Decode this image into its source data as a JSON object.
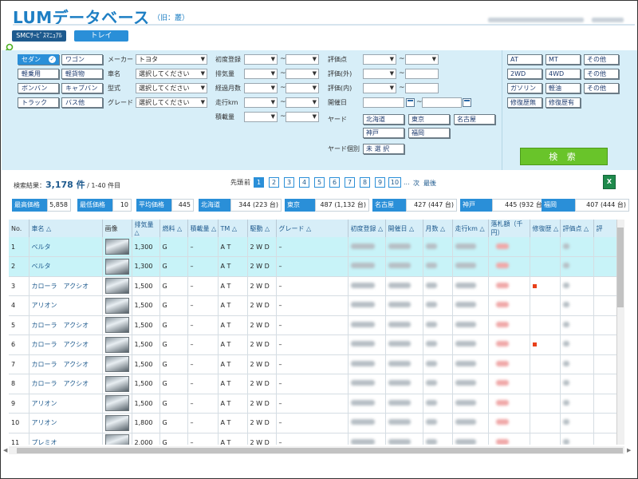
{
  "header": {
    "title": "LUMデータベース",
    "subtitle": "（旧：叢）"
  },
  "nav": {
    "smc_label": "SMCｻｰﾋﾞｽﾏﾆｭｱﾙ",
    "tray_label": "トレイ"
  },
  "categories": [
    {
      "label": "セダン",
      "selected": true
    },
    {
      "label": "ワゴン"
    },
    {
      "label": "軽乗用"
    },
    {
      "label": "軽貨物"
    },
    {
      "label": "ボンバン"
    },
    {
      "label": "キャブバン"
    },
    {
      "label": "トラック"
    },
    {
      "label": "バス他"
    }
  ],
  "filters": {
    "maker_label": "メーカー",
    "maker_value": "トヨタ",
    "model_label": "車名",
    "model_value": "選択してください",
    "type_label": "型式",
    "type_value": "選択してください",
    "grade_label": "グレード",
    "grade_value": "選択してください",
    "first_reg_label": "初度登録",
    "displacement_label": "排気量",
    "months_label": "経過月数",
    "mileage_label": "走行km",
    "load_label": "積載量",
    "score_label": "評価点",
    "score_ext_label": "評価(外)",
    "score_int_label": "評価(内)",
    "date_label": "開催日",
    "yard_label": "ヤード",
    "yard_indiv_label": "ヤード個別",
    "yard_indiv_value": "未 選 択",
    "tilde": "~"
  },
  "yards": [
    "北海道",
    "東京",
    "名古屋",
    "神戸",
    "福岡"
  ],
  "options": [
    "AT",
    "MT",
    "その他",
    "2WD",
    "4WD",
    "その他",
    "ガソリン",
    "軽油",
    "その他",
    "修復歴無",
    "修復歴有"
  ],
  "search_label": "検 索",
  "results": {
    "prefix": "検索結果：",
    "count": "3,178 件",
    "range": "/ 1-40 件目"
  },
  "pager": {
    "first": "先頭",
    "prev": "前",
    "pages": [
      "1",
      "2",
      "3",
      "4",
      "5",
      "6",
      "7",
      "8",
      "9",
      "10"
    ],
    "ellipsis": "...",
    "next": "次",
    "last": "最後"
  },
  "stats": [
    {
      "k": "最高価格",
      "v": "5,858"
    },
    {
      "k": "最低価格",
      "v": "10"
    },
    {
      "k": "平均価格",
      "v": "445"
    },
    {
      "k": "北海道",
      "v": "344 (223 台)"
    },
    {
      "k": "東京",
      "v": "487 (1,132 台)"
    },
    {
      "k": "名古屋",
      "v": "427 (447 台)"
    },
    {
      "k": "神戸",
      "v": "445 (932 台)"
    },
    {
      "k": "福岡",
      "v": "407 (444 台)"
    }
  ],
  "table": {
    "headers": [
      "No.",
      "車名 △",
      "画像",
      "排気量 △",
      "燃料 △",
      "積載量 △",
      "TM △",
      "駆動 △",
      "グレード △",
      "初度登録 △",
      "開催日 △",
      "月数 △",
      "走行km △",
      "落札額（千円）",
      "修復歴 △",
      "評価点 △",
      "評"
    ],
    "rows": [
      {
        "no": "1",
        "name": "ベルタ",
        "cc": "1,300",
        "fuel": "G",
        "load": "–",
        "tm": "A T",
        "drive": "2 W D",
        "grade": "–",
        "mark": false
      },
      {
        "no": "2",
        "name": "ベルタ",
        "cc": "1,300",
        "fuel": "G",
        "load": "–",
        "tm": "A T",
        "drive": "2 W D",
        "grade": "–",
        "mark": false
      },
      {
        "no": "3",
        "name": "カローラ　アクシオ",
        "cc": "1,500",
        "fuel": "G",
        "load": "–",
        "tm": "A T",
        "drive": "2 W D",
        "grade": "–",
        "mark": true
      },
      {
        "no": "4",
        "name": "アリオン",
        "cc": "1,500",
        "fuel": "G",
        "load": "–",
        "tm": "A T",
        "drive": "2 W D",
        "grade": "–",
        "mark": false
      },
      {
        "no": "5",
        "name": "カローラ　アクシオ",
        "cc": "1,500",
        "fuel": "G",
        "load": "–",
        "tm": "A T",
        "drive": "2 W D",
        "grade": "–",
        "mark": false
      },
      {
        "no": "6",
        "name": "カローラ　アクシオ",
        "cc": "1,500",
        "fuel": "G",
        "load": "–",
        "tm": "A T",
        "drive": "2 W D",
        "grade": "–",
        "mark": true
      },
      {
        "no": "7",
        "name": "カローラ　アクシオ",
        "cc": "1,500",
        "fuel": "G",
        "load": "–",
        "tm": "A T",
        "drive": "2 W D",
        "grade": "–",
        "mark": false
      },
      {
        "no": "8",
        "name": "カローラ　アクシオ",
        "cc": "1,500",
        "fuel": "G",
        "load": "–",
        "tm": "A T",
        "drive": "2 W D",
        "grade": "–",
        "mark": false
      },
      {
        "no": "9",
        "name": "アリオン",
        "cc": "1,500",
        "fuel": "G",
        "load": "–",
        "tm": "A T",
        "drive": "2 W D",
        "grade": "–",
        "mark": false
      },
      {
        "no": "10",
        "name": "アリオン",
        "cc": "1,800",
        "fuel": "G",
        "load": "–",
        "tm": "A T",
        "drive": "2 W D",
        "grade": "–",
        "mark": false
      },
      {
        "no": "11",
        "name": "プレミオ",
        "cc": "2,000",
        "fuel": "G",
        "load": "–",
        "tm": "A T",
        "drive": "2 W D",
        "grade": "–",
        "mark": false
      }
    ]
  },
  "colors": {
    "accent": "#2a8fd8",
    "logo": "#1e7fc4",
    "panel": "#d7eef8",
    "search": "#69c42a",
    "highlight": "#c8f3f8"
  }
}
